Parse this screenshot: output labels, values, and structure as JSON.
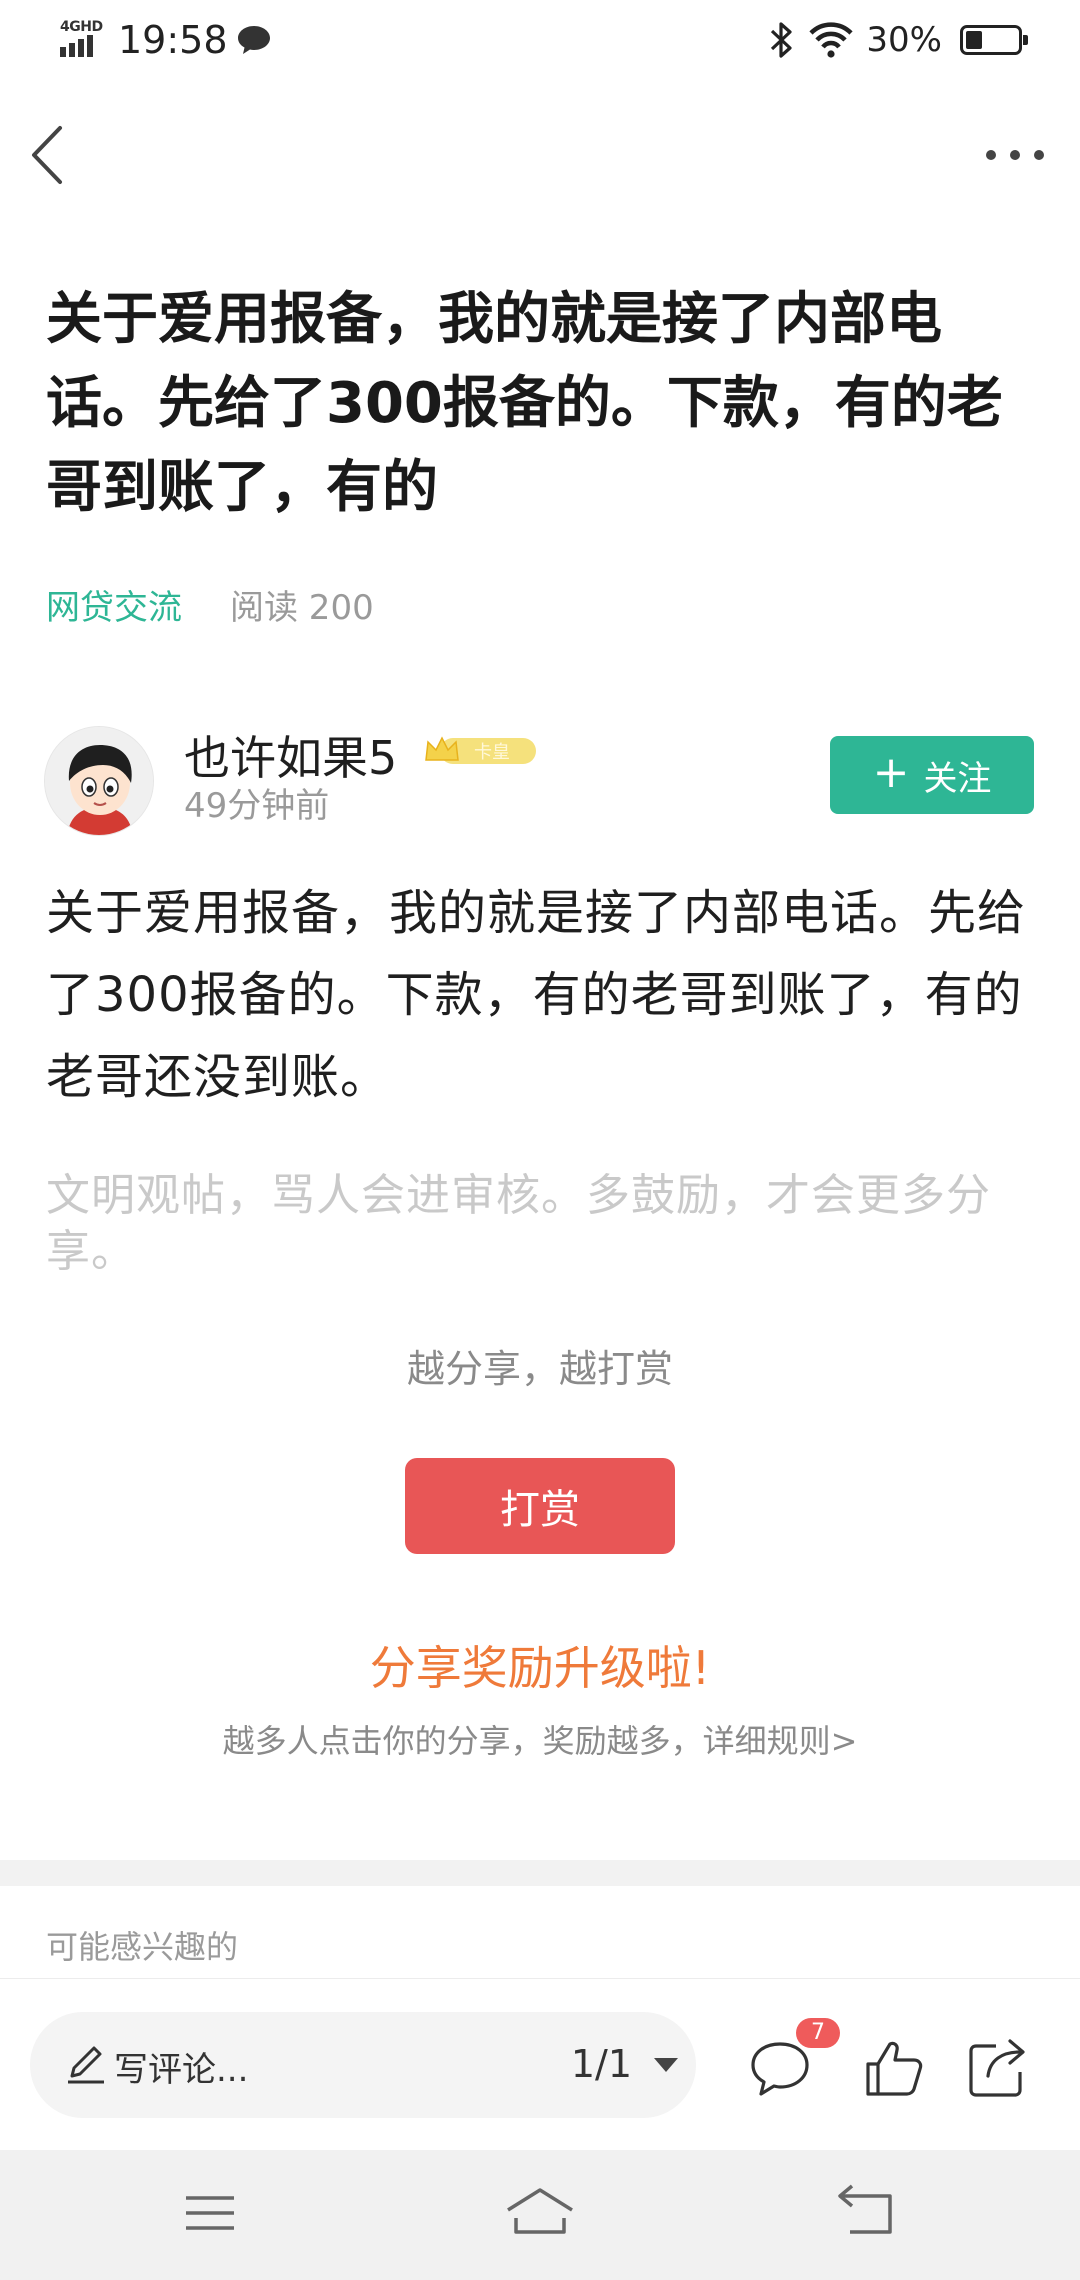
{
  "status_bar": {
    "network": "4GHD",
    "time": "19:58",
    "battery_percent": "30%",
    "battery_level": 0.3,
    "icons": [
      "signal-icon",
      "message-icon",
      "bluetooth-icon",
      "wifi-icon",
      "battery-icon"
    ]
  },
  "nav": {
    "back_icon": "chevron-left-icon",
    "more_icon": "more-dots-icon"
  },
  "post": {
    "title": "关于爱用报备，我的就是接了内部电话。先给了300报备的。下款，有的老哥到账了，有的",
    "category": "网贷交流",
    "read_count": "阅读 200",
    "body": "关于爱用报备，我的就是接了内部电话。先给了300报备的。下款，有的老哥到账了，有的老哥还没到账。"
  },
  "author": {
    "name": "也许如果5",
    "badge": "卡皇",
    "time_ago": "49分钟前",
    "follow_label": "关注",
    "follow_plus": "+"
  },
  "hint": {
    "text": "文明观帖，骂人会进审核。多鼓励，才会更多分享。"
  },
  "reward": {
    "hint": "越分享，越打赏",
    "button_label": "打赏",
    "upgrade_title": "分享奖励升级啦!",
    "upgrade_sub": "越多人点击你的分享，奖励越多，详细规则>"
  },
  "related": {
    "label": "可能感兴趣的"
  },
  "comment_bar": {
    "placeholder": "写评论...",
    "page_indicator": "1/1",
    "comment_count": "7"
  },
  "colors": {
    "accent_green": "#2eb695",
    "reward_red": "#e85656",
    "upgrade_orange": "#ef7a3a",
    "badge_red": "#ef5b5b"
  }
}
